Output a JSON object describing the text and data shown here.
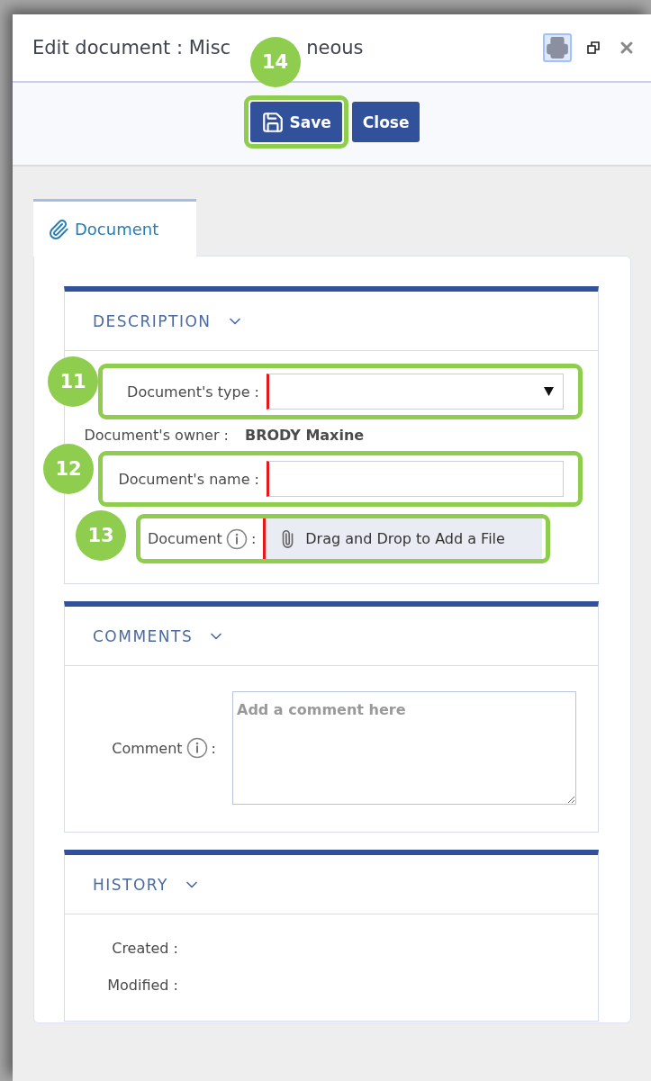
{
  "window": {
    "title_parts": [
      "Edit document : Misc",
      "neous"
    ],
    "actions": [
      {
        "kind": "print",
        "highlighted": true
      },
      {
        "kind": "restore",
        "highlighted": false
      },
      {
        "kind": "close",
        "highlighted": false
      }
    ]
  },
  "toolbar": {
    "buttons": [
      {
        "kind": "save",
        "label": "Save",
        "callout": "14"
      },
      {
        "kind": "plain",
        "label": "Close"
      }
    ]
  },
  "tabs": [
    {
      "label": "Document",
      "selected": true
    }
  ],
  "sections": [
    {
      "kind": "form",
      "title": "DESCRIPTION",
      "expanded": true,
      "fields": [
        {
          "kind": "select",
          "label": "Document's type :",
          "required": true,
          "callout": "11"
        },
        {
          "kind": "readonly",
          "label": "Document's owner :",
          "value": "BRODY Maxine"
        },
        {
          "kind": "text",
          "label": "Document's name :",
          "required": true,
          "callout": "12"
        },
        {
          "kind": "file",
          "label": "Document",
          "info": true,
          "suffix": ":",
          "placeholder": "Drag and Drop to Add a File",
          "required": true,
          "callout": "13"
        }
      ]
    },
    {
      "kind": "comment",
      "title": "COMMENTS",
      "expanded": true,
      "fields": [
        {
          "kind": "textarea",
          "label": "Comment",
          "info": true,
          "suffix": ":",
          "placeholder": "Add a comment here"
        }
      ]
    },
    {
      "kind": "history",
      "title": "HISTORY",
      "expanded": true,
      "fields": [
        {
          "kind": "readonly",
          "label": "Created :"
        },
        {
          "kind": "readonly",
          "label": "Modified :"
        }
      ]
    }
  ]
}
